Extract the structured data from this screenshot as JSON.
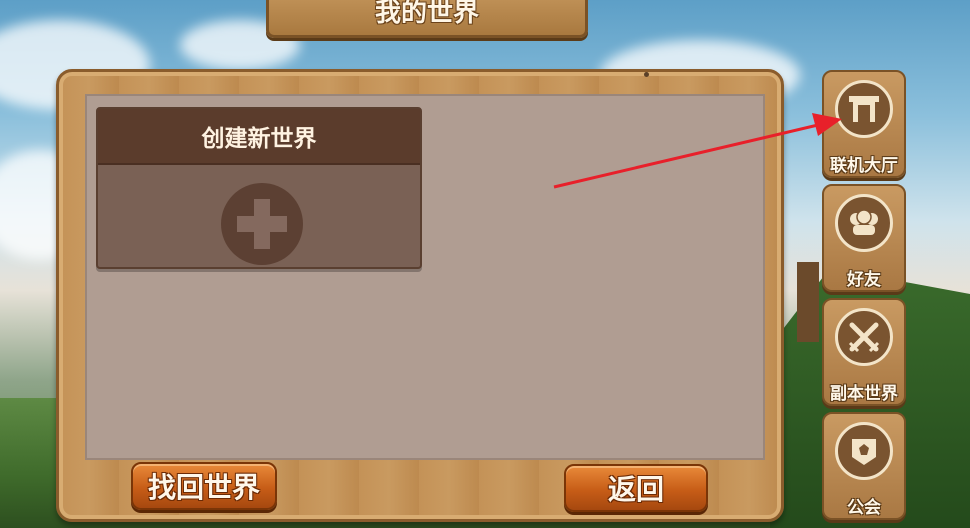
{
  "title": "我的世界",
  "create_card": {
    "label": "创建新世界",
    "icon": "plus-icon"
  },
  "buttons": {
    "recover": "找回世界",
    "back": "返回"
  },
  "side_menu": [
    {
      "label": "联机大厅",
      "icon": "gate-icon"
    },
    {
      "label": "好友",
      "icon": "friends-icon"
    },
    {
      "label": "副本世界",
      "icon": "crossed-swords-icon"
    },
    {
      "label": "公会",
      "icon": "guild-banner-icon"
    }
  ],
  "annotation": {
    "color": "#e8202a",
    "target": "联机大厅"
  }
}
